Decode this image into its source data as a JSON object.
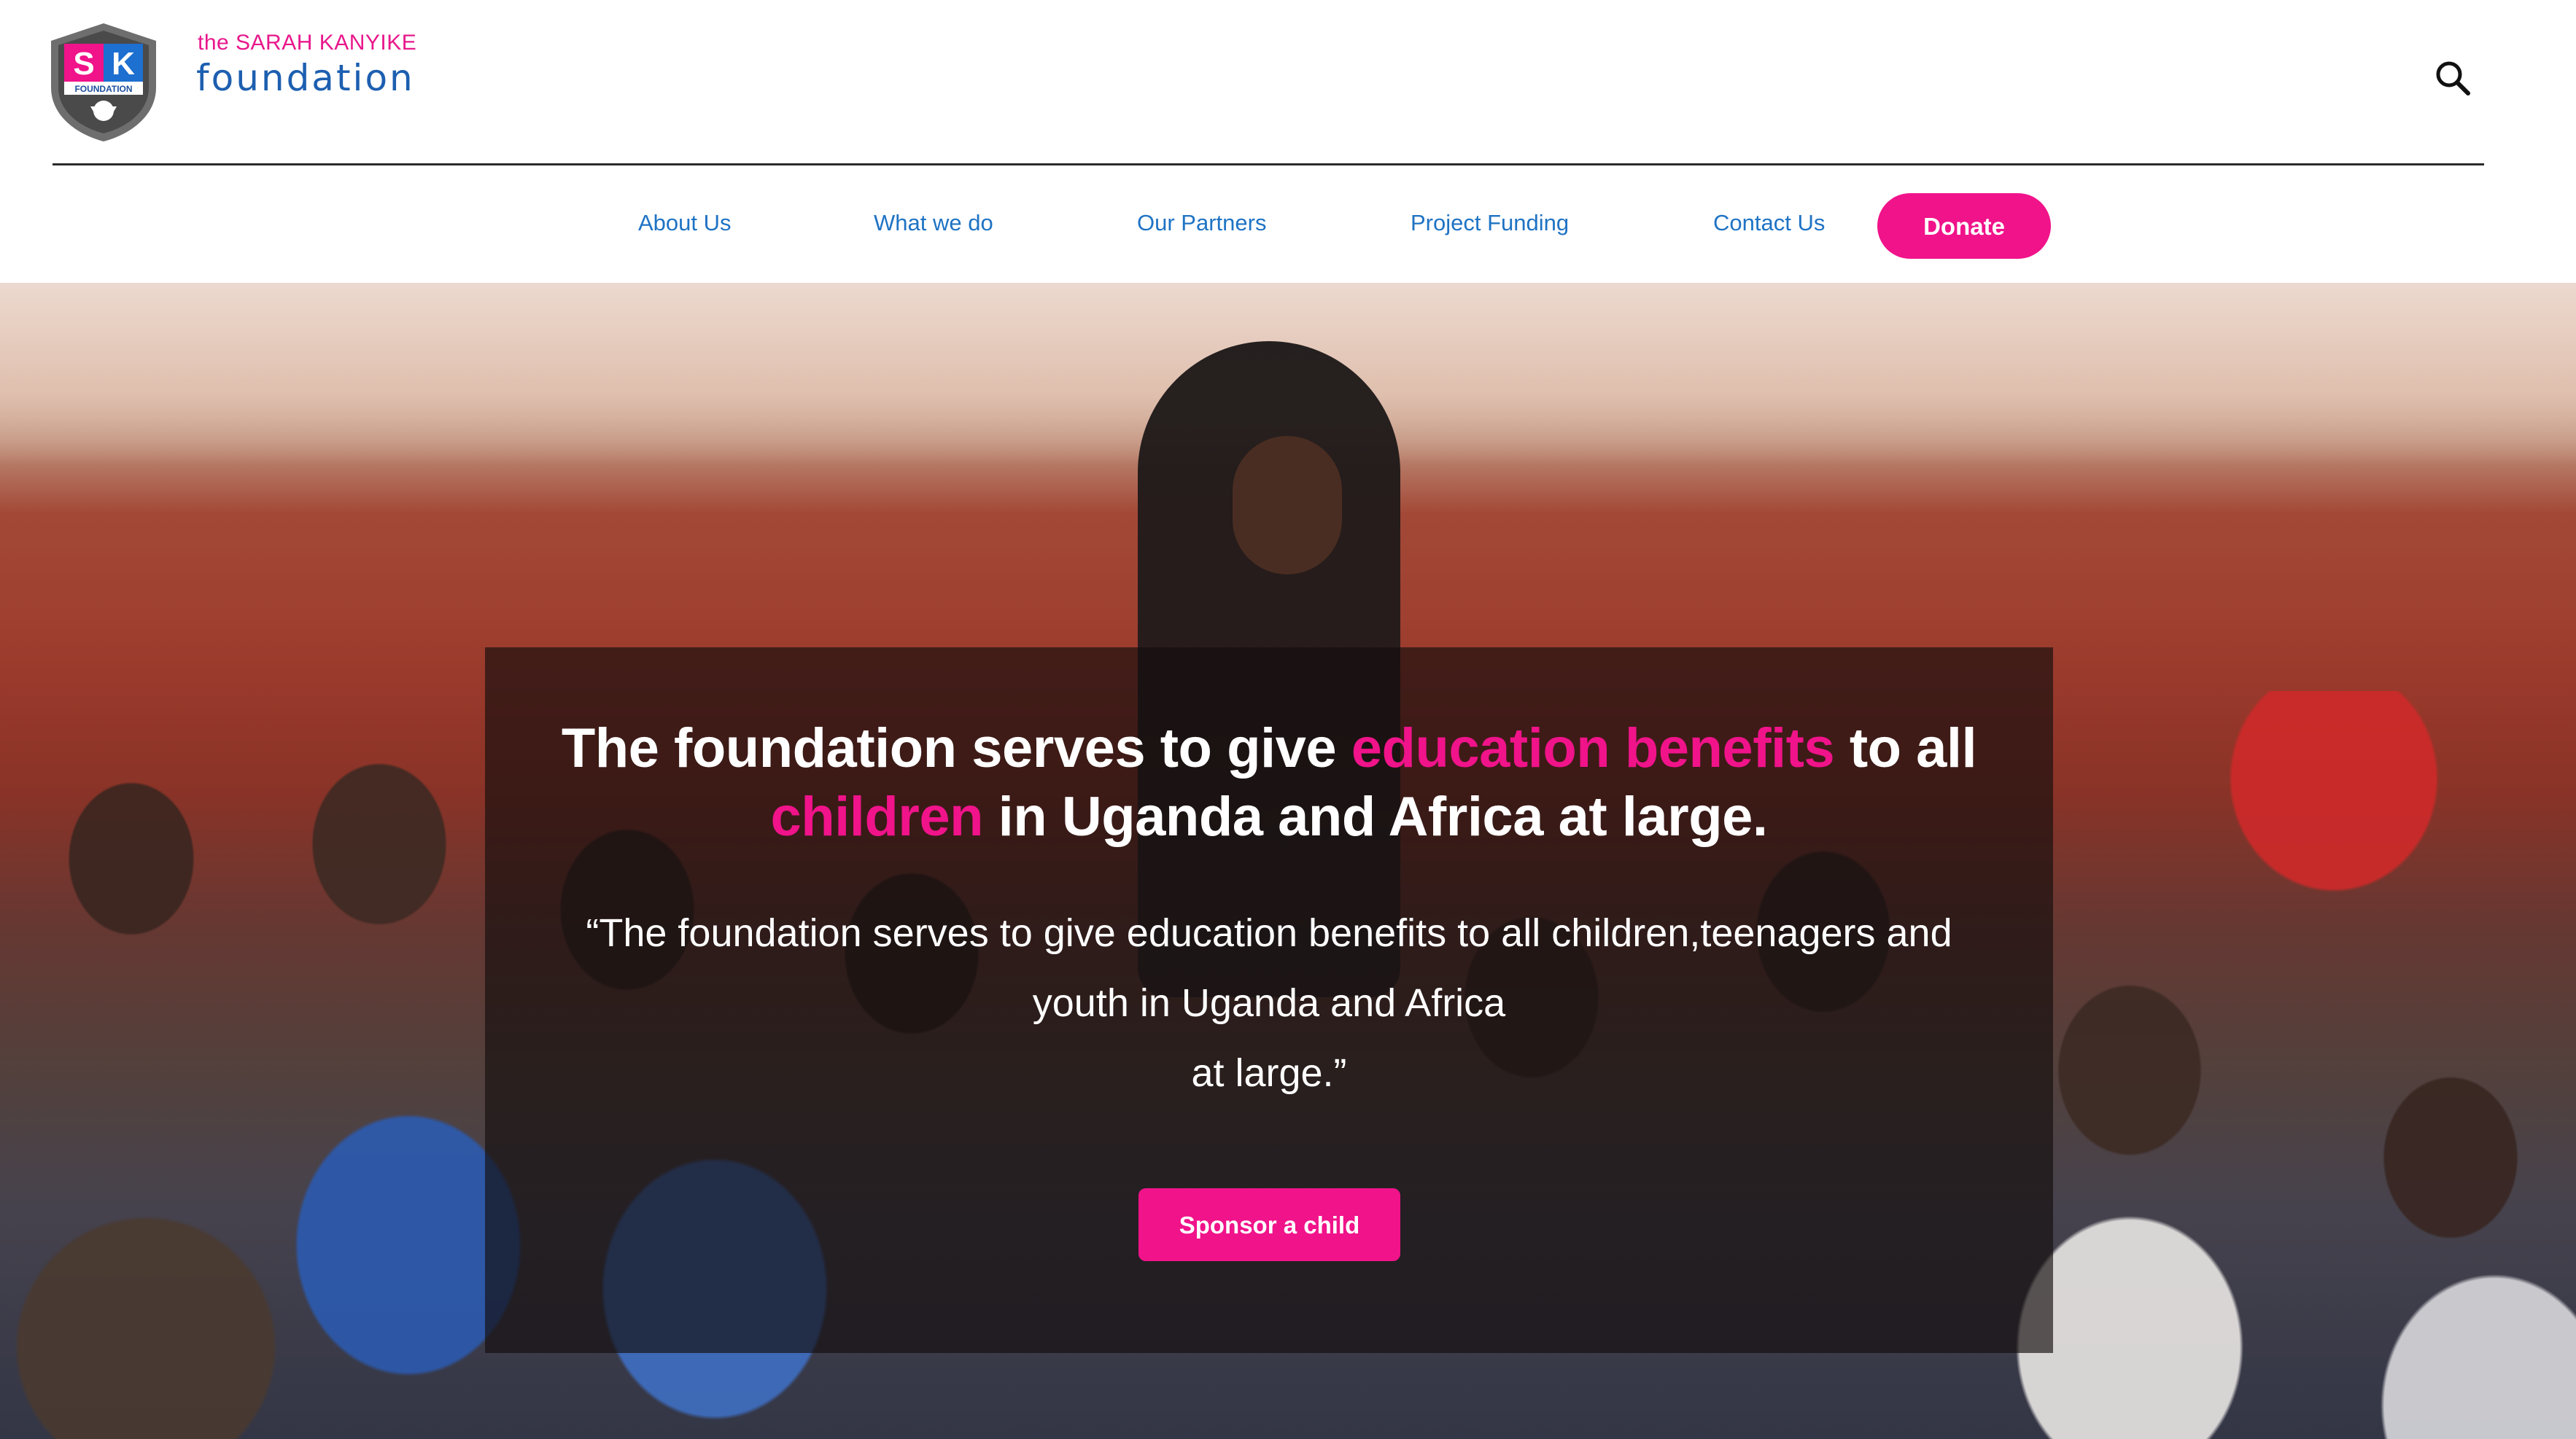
{
  "brand": {
    "logo_letters": "SK",
    "logo_banner": "FOUNDATION",
    "tagline_prefix": "the SARAH KANYIKE",
    "name": "foundation"
  },
  "header": {
    "search_icon": "search-icon"
  },
  "nav": {
    "items": [
      {
        "label": "About Us"
      },
      {
        "label": "What we do"
      },
      {
        "label": "Our Partners"
      },
      {
        "label": "Project Funding"
      },
      {
        "label": "Contact Us"
      }
    ],
    "donate_label": "Donate"
  },
  "hero": {
    "headline_part1": "The foundation serves to give ",
    "headline_highlight1": "education benefits",
    "headline_part2": " to all ",
    "headline_highlight2": "children",
    "headline_part3": " in Uganda and Africa at large.",
    "quote_line1": "“The foundation serves to give education benefits to all children,teenagers and",
    "quote_line2": "youth in Uganda and Africa",
    "quote_line3": "at large.”",
    "cta_label": "Sponsor a child"
  },
  "colors": {
    "accent_pink": "#f0138a",
    "brand_blue": "#1d5fb0",
    "nav_blue": "#1f73c4"
  }
}
